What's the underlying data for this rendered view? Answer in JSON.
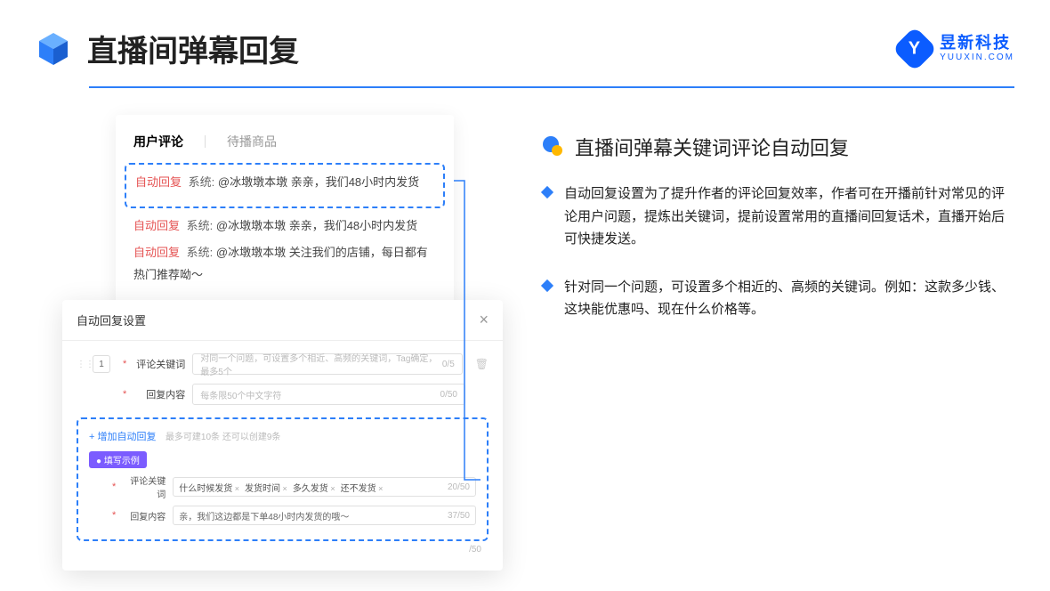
{
  "header": {
    "title": "直播间弹幕回复",
    "brand_name": "昱新科技",
    "brand_sub": "YUUXIN.COM"
  },
  "comments": {
    "tab_active": "用户评论",
    "tab_inactive": "待播商品",
    "auto_reply_label": "自动回复",
    "system_label": "系统:",
    "highlighted": "@冰墩墩本墩 亲亲，我们48小时内发货",
    "line2": "@冰墩墩本墩 亲亲，我们48小时内发货",
    "line3": "@冰墩墩本墩 关注我们的店铺，每日都有热门推荐呦～"
  },
  "modal": {
    "title": "自动回复设置",
    "close": "×",
    "row_num": "1",
    "keyword_label": "评论关键词",
    "keyword_placeholder": "对同一个问题，可设置多个相近、高频的关键词，Tag确定，最多5个",
    "keyword_count": "0/5",
    "content_label": "回复内容",
    "content_placeholder": "每条限50个中文字符",
    "content_count": "0/50",
    "add_link": "+ 增加自动回复",
    "add_hint": "最多可建10条 还可以创建9条",
    "example_badge": "● 填写示例",
    "example_keyword_label": "评论关键词",
    "example_tags": [
      "什么时候发货",
      "发货时间",
      "多久发货",
      "还不发货"
    ],
    "example_keyword_count": "20/50",
    "example_content_label": "回复内容",
    "example_content_text": "亲，我们这边都是下单48小时内发货的哦～",
    "example_content_count": "37/50",
    "outer_count": "/50"
  },
  "info": {
    "title": "直播间弹幕关键词评论自动回复",
    "bullet1": "自动回复设置为了提升作者的评论回复效率，作者可在开播前针对常见的评论用户问题，提炼出关键词，提前设置常用的直播间回复话术，直播开始后可快捷发送。",
    "bullet2": "针对同一个问题，可设置多个相近的、高频的关键词。例如：这款多少钱、这块能优惠吗、现在什么价格等。"
  }
}
